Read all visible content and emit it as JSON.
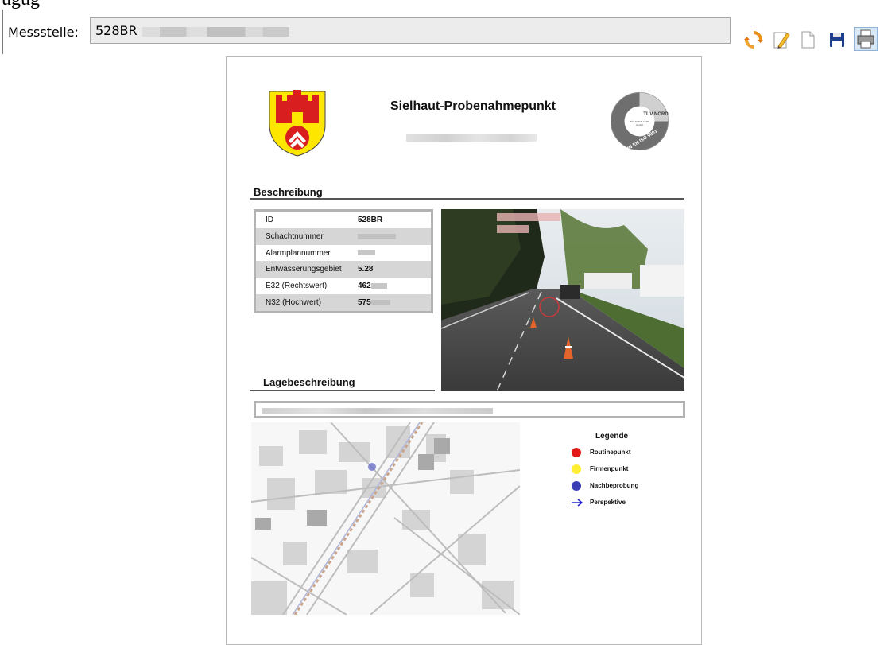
{
  "header": {
    "cut_label": "ügüg"
  },
  "toolbar": {
    "label": "Messstelle:",
    "value": "528BR",
    "icons": [
      "refresh-icon",
      "edit-icon",
      "new-document-icon",
      "save-icon",
      "print-icon"
    ]
  },
  "document": {
    "title": "Sielhaut-Probenahmepunkt",
    "certification": {
      "brand": "TÜV NORD",
      "line1": "TÜV NORD CERT",
      "line2": "GmbH",
      "standard": "DIN EN ISO 9001"
    },
    "beschreibung": {
      "heading": "Beschreibung",
      "rows": [
        {
          "key": "ID",
          "value": "528BR"
        },
        {
          "key": "Schachtnummer",
          "value": ""
        },
        {
          "key": "Alarmplannummer",
          "value": ""
        },
        {
          "key": "Entwässerungsgebiet",
          "value": "5.28"
        },
        {
          "key": "E32 (Rechtswert)",
          "value": "462"
        },
        {
          "key": "N32 (Hochwert)",
          "value": "575"
        }
      ]
    },
    "lagebeschreibung": {
      "heading": "Lagebeschreibung"
    },
    "legend": {
      "title": "Legende",
      "items": [
        {
          "label": "Routinepunkt",
          "symbol": "dot",
          "color": "#e31919"
        },
        {
          "label": "Firmenpunkt",
          "symbol": "dot",
          "color": "#ffee33"
        },
        {
          "label": "Nachbeprobung",
          "symbol": "dot",
          "color": "#3a3fb5"
        },
        {
          "label": "Perspektive",
          "symbol": "arrow",
          "color": "#2222cc"
        }
      ]
    }
  }
}
